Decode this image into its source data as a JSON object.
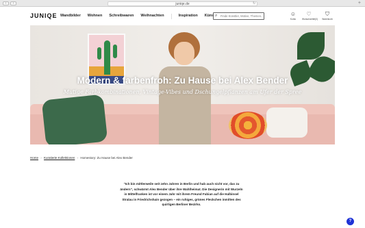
{
  "browser": {
    "url": "juniqe.de",
    "back_glyph": "‹",
    "forward_glyph": "›",
    "reload_glyph": "↻",
    "new_tab_glyph": "+"
  },
  "header": {
    "logo": "JUNIQE",
    "nav": [
      "Wandbilder",
      "Wohnen",
      "Schreibwaren",
      "Weihnachten",
      "Inspiration",
      "Künstler"
    ],
    "search_placeholder": "Finde Künstler, Motive, Themen...",
    "icons": [
      {
        "name": "user-icon",
        "glyph": "☺",
        "label": "Konto"
      },
      {
        "name": "heart-icon",
        "glyph": "♡",
        "label": "Wunschzettel(0)"
      },
      {
        "name": "bag-icon",
        "glyph": "⛉",
        "label": "Warenkorb"
      }
    ]
  },
  "hero": {
    "title": "Modern & farbenfroh: Zu Hause bei Alex Bender",
    "subtitle": "Mutige Farbkombinationen, Vintage-Vibes und Dschungelpflanzen am Ufer der Spree"
  },
  "breadcrumb": {
    "items": [
      "Home",
      "Kuratierte Kollektionen",
      "Homestory: Zu Hause bei Alex Bender"
    ],
    "separator": "›"
  },
  "intro": {
    "text": "\"Ich bin mittlerweile seit zehn Jahren in Berlin und hab auch nicht vor, das zu ändern\", schwärmt Alex Bender über ihre Wahlheimat. Die Designerin mit Wurzeln in Mittelfranken ist vor einem Jahr mit ihrem Freund Fabian auf die Halbinsel Stralau in Friedrichshain gezogen – ein ruhiges, grünes Fleckchen inmitten des quirligen Berliner Bezirks."
  },
  "help": {
    "label": "?"
  },
  "colors": {
    "accent": "#1f33d6",
    "brand": "#111111"
  }
}
